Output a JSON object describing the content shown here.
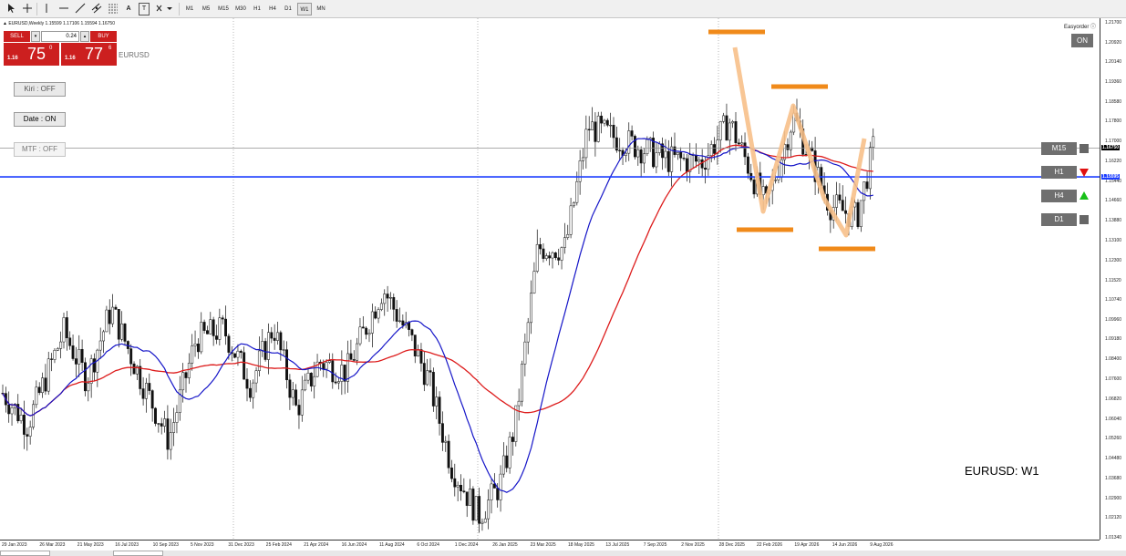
{
  "toolbar": {
    "tools": [
      "cursor",
      "crosshair",
      "vertical-line",
      "horizontal-line",
      "trendline",
      "channel",
      "fibonacci",
      "text",
      "label",
      "shapes"
    ],
    "text_tool": "A",
    "label_tool": "T",
    "timeframes": [
      "M1",
      "M5",
      "M15",
      "M30",
      "H1",
      "H4",
      "D1",
      "W1",
      "MN"
    ],
    "active_timeframe": "W1"
  },
  "symbol_info": "▲ EURUSD,Weekly  1.15599 1.17106 1.15594 1.16750",
  "trade_panel": {
    "sell_label": "SELL",
    "buy_label": "BUY",
    "lot": "0.24",
    "bid_prefix": "1.16",
    "bid_big": "75",
    "bid_sup": "0",
    "ask_prefix": "1.16",
    "ask_big": "77",
    "ask_sup": "6",
    "symbol": "EURUSD"
  },
  "buttons": {
    "kiri": "Kiri : OFF",
    "date": "Date : ON",
    "mtf": "MTF : OFF"
  },
  "easyorder": {
    "label": "Easyorder ⓘ",
    "on_label": "ON"
  },
  "mtf_panel": [
    {
      "label": "M15",
      "signal": "neutral"
    },
    {
      "label": "H1",
      "signal": "down"
    },
    {
      "label": "H4",
      "signal": "up"
    },
    {
      "label": "D1",
      "signal": "neutral"
    }
  ],
  "caption": "EURUSD: W1",
  "colors": {
    "ma_fast": "#1515c8",
    "ma_slow": "#dd1c1c",
    "pattern_levels": "#f08a1a",
    "pattern_zigzag": "#f7c08a",
    "sell_buy_bg": "#cc1f1f",
    "h1_down": "#e01010",
    "h4_up": "#18c018"
  },
  "price_axis": {
    "labels": [
      "1.21700",
      "1.20920",
      "1.20140",
      "1.19360",
      "1.18580",
      "1.17800",
      "1.17000",
      "1.16220",
      "1.15440",
      "1.14660",
      "1.13880",
      "1.13100",
      "1.12300",
      "1.11520",
      "1.10740",
      "1.09960",
      "1.09180",
      "1.08400",
      "1.07600",
      "1.06820",
      "1.06040",
      "1.05260",
      "1.04480",
      "1.03680",
      "1.02900",
      "1.02120",
      "1.01340"
    ],
    "current_price": "1.16750",
    "bid_line_price": "1.15595",
    "ask_line_price": "1.15620",
    "max": 1.217,
    "min": 1.0134
  },
  "time_axis": {
    "labels": [
      "29 Jan 2023",
      "26 Mar 2023",
      "21 May 2023",
      "16 Jul 2023",
      "10 Sep 2023",
      "5 Nov 2023",
      "31 Dec 2023",
      "25 Feb 2024",
      "21 Apr 2024",
      "16 Jun 2024",
      "11 Aug 2024",
      "6 Oct 2024",
      "1 Dec 2024",
      "26 Jan 2025",
      "23 Mar 2025",
      "18 May 2025",
      "13 Jul 2025",
      "7 Sep 2025",
      "2 Nov 2025",
      "28 Dec 2025",
      "22 Feb 2026",
      "19 Apr 2026",
      "14 Jun 2026",
      "9 Aug 2026"
    ]
  }
}
